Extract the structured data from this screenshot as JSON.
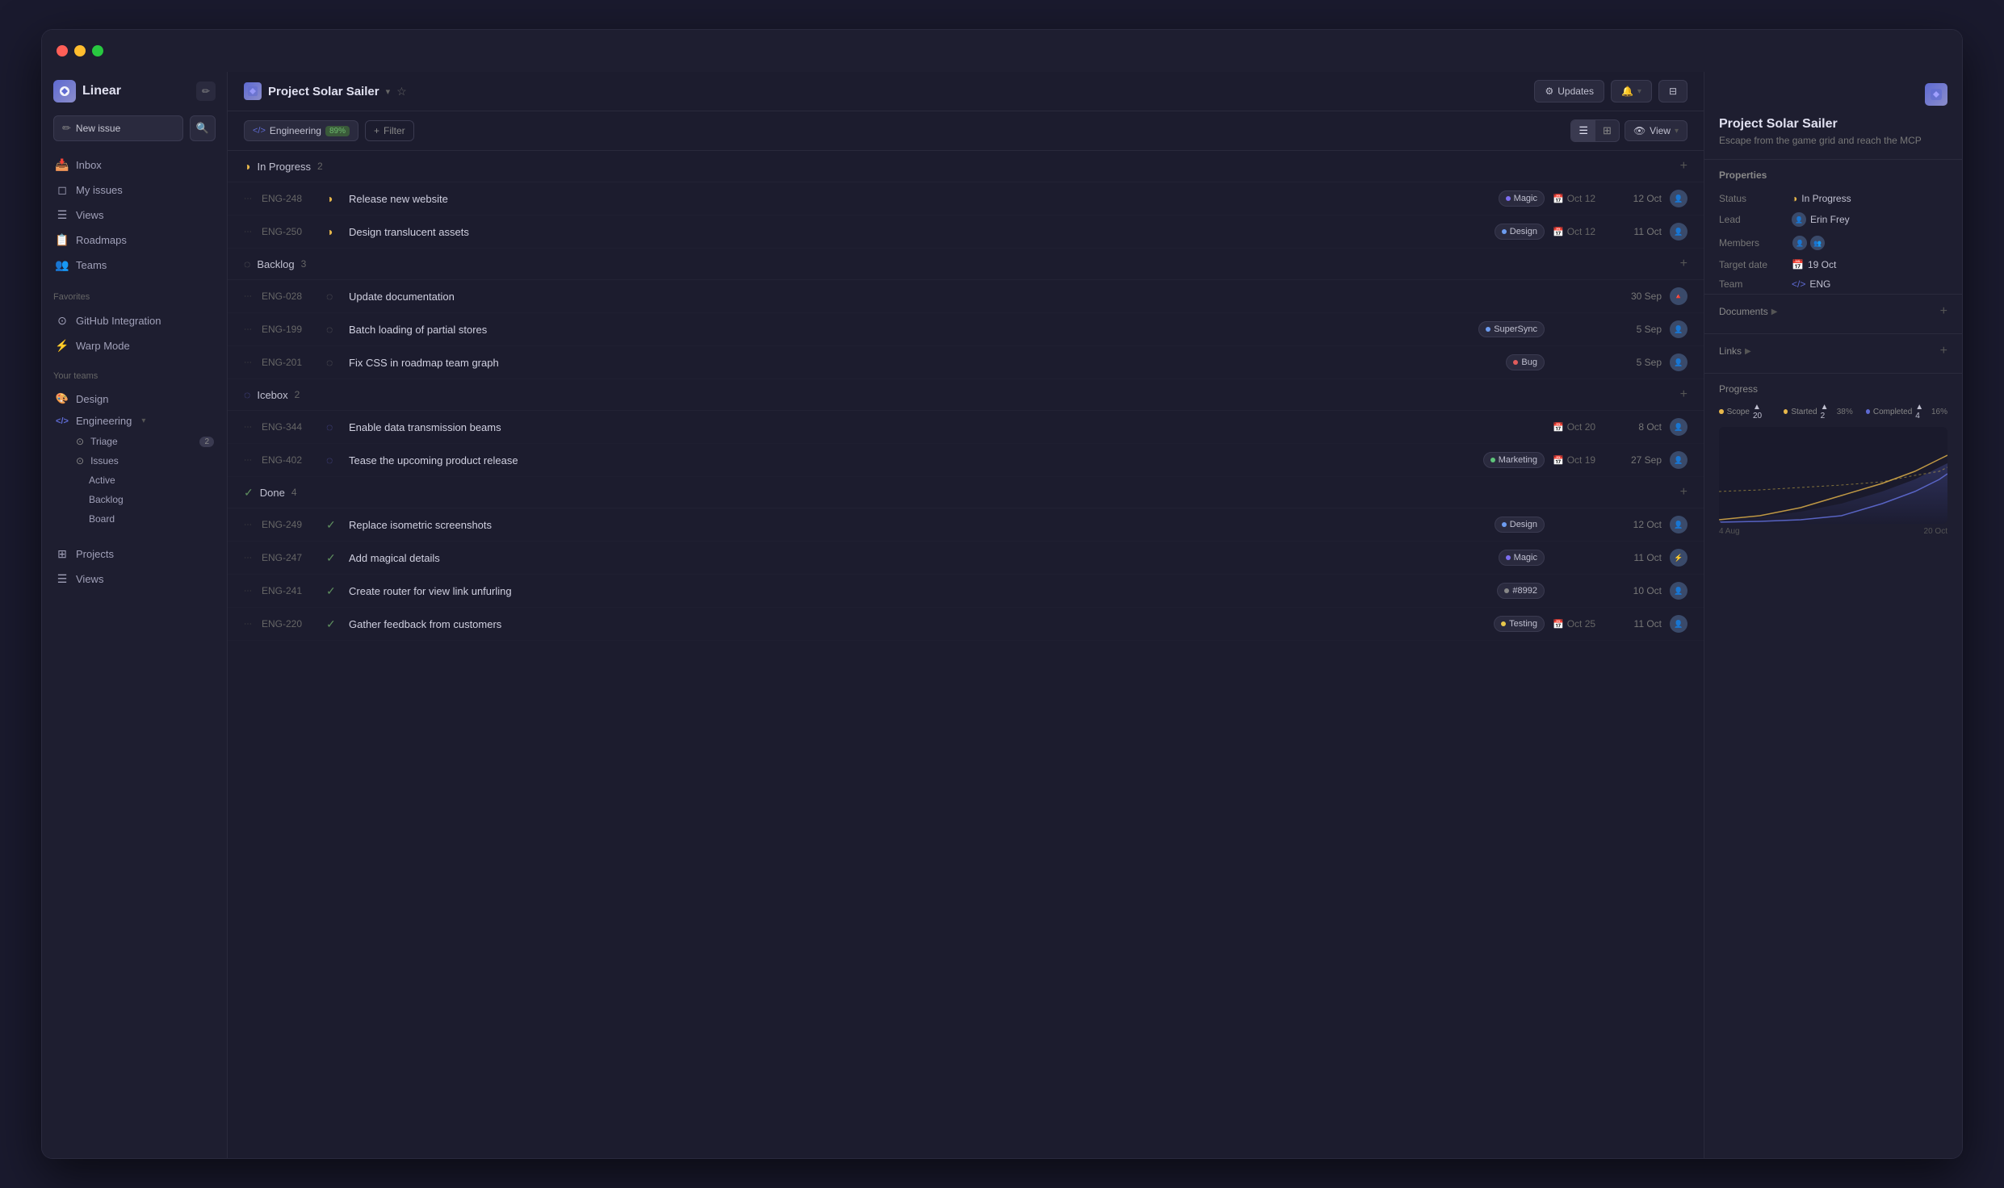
{
  "window": {
    "title": "Linear - Project Solar Sailer"
  },
  "sidebar": {
    "brand": "Linear",
    "brand_icon": "🚀",
    "new_issue_label": "New issue",
    "nav_items": [
      {
        "id": "inbox",
        "label": "Inbox",
        "icon": "📥"
      },
      {
        "id": "my_issues",
        "label": "My issues",
        "icon": "🔲"
      },
      {
        "id": "views",
        "label": "Views",
        "icon": "☰"
      },
      {
        "id": "roadmaps",
        "label": "Roadmaps",
        "icon": "🗺"
      },
      {
        "id": "teams",
        "label": "Teams",
        "icon": "👥"
      }
    ],
    "favorites_label": "Favorites",
    "favorites": [
      {
        "id": "github",
        "label": "GitHub Integration",
        "icon": "⚙"
      },
      {
        "id": "warp",
        "label": "Warp Mode",
        "icon": "⚡"
      }
    ],
    "your_teams_label": "Your teams",
    "teams": [
      {
        "id": "design",
        "label": "Design",
        "icon": "🎨"
      },
      {
        "id": "engineering",
        "label": "Engineering",
        "icon": "</>",
        "has_arrow": true
      }
    ],
    "engineering_sub": [
      {
        "id": "triage",
        "label": "Triage",
        "badge": "2"
      },
      {
        "id": "issues",
        "label": "Issues"
      }
    ],
    "issues_sub": [
      {
        "id": "active",
        "label": "Active"
      },
      {
        "id": "backlog",
        "label": "Backlog"
      },
      {
        "id": "board",
        "label": "Board"
      }
    ],
    "bottom_items": [
      {
        "id": "projects",
        "label": "Projects",
        "icon": "⊞"
      },
      {
        "id": "views2",
        "label": "Views",
        "icon": "☰"
      }
    ]
  },
  "header": {
    "project_name": "Project Solar Sailer",
    "updates_label": "Updates",
    "team_tag": "Engineering",
    "team_percent": "89%",
    "filter_label": "Filter",
    "view_label": "View"
  },
  "project_detail": {
    "title": "Project Solar Sailer",
    "subtitle": "Escape from the game grid and reach the MCP",
    "properties": {
      "title": "Properties",
      "status_label": "Status",
      "status_value": "In Progress",
      "lead_label": "Lead",
      "lead_value": "Erin Frey",
      "members_label": "Members",
      "target_date_label": "Target date",
      "target_date_value": "19 Oct",
      "team_label": "Team",
      "team_value": "ENG"
    },
    "documents_label": "Documents",
    "links_label": "Links",
    "progress": {
      "title": "Progress",
      "scope_label": "Scope",
      "scope_count": "▲ 20",
      "started_label": "Started",
      "started_count": "▲ 2",
      "started_percent": "38%",
      "completed_label": "Completed",
      "completed_count": "▲ 4",
      "completed_percent": "16%",
      "date_start": "4 Aug",
      "date_end": "20 Oct"
    }
  },
  "groups": [
    {
      "id": "in_progress",
      "name": "In Progress",
      "count": "2",
      "status": "inprogress",
      "issues": [
        {
          "id": "ENG-248",
          "title": "Release new website",
          "labels": [
            {
              "name": "Magic",
              "color": "#7c6ef0"
            }
          ],
          "due_date": "Oct 12",
          "meta_date": "12 Oct",
          "status": "inprogress"
        },
        {
          "id": "ENG-250",
          "title": "Design translucent assets",
          "labels": [
            {
              "name": "Design",
              "color": "#6d9cf0"
            }
          ],
          "due_date": "Oct 12",
          "meta_date": "11 Oct",
          "status": "inprogress"
        }
      ]
    },
    {
      "id": "backlog",
      "name": "Backlog",
      "count": "3",
      "status": "backlog",
      "issues": [
        {
          "id": "ENG-028",
          "title": "Update documentation",
          "labels": [],
          "due_date": "",
          "meta_date": "30 Sep",
          "status": "backlog"
        },
        {
          "id": "ENG-199",
          "title": "Batch loading of partial stores",
          "labels": [
            {
              "name": "SuperSync",
              "color": "#6d9cf0"
            }
          ],
          "due_date": "",
          "meta_date": "5 Sep",
          "status": "backlog"
        },
        {
          "id": "ENG-201",
          "title": "Fix CSS in roadmap team graph",
          "labels": [
            {
              "name": "Bug",
              "color": "#e05c5c"
            }
          ],
          "due_date": "",
          "meta_date": "5 Sep",
          "status": "backlog"
        }
      ]
    },
    {
      "id": "icebox",
      "name": "Icebox",
      "count": "2",
      "status": "icebox",
      "issues": [
        {
          "id": "ENG-344",
          "title": "Enable data transmission beams",
          "labels": [],
          "due_date": "Oct 20",
          "meta_date": "8 Oct",
          "status": "icebox"
        },
        {
          "id": "ENG-402",
          "title": "Tease the upcoming product release",
          "labels": [
            {
              "name": "Marketing",
              "color": "#5ec47a"
            }
          ],
          "due_date": "Oct 19",
          "meta_date": "27 Sep",
          "status": "icebox"
        }
      ]
    },
    {
      "id": "done",
      "name": "Done",
      "count": "4",
      "status": "done",
      "issues": [
        {
          "id": "ENG-249",
          "title": "Replace isometric screenshots",
          "labels": [
            {
              "name": "Design",
              "color": "#6d9cf0"
            }
          ],
          "due_date": "",
          "meta_date": "12 Oct",
          "status": "done"
        },
        {
          "id": "ENG-247",
          "title": "Add magical details",
          "labels": [
            {
              "name": "Magic",
              "color": "#7c6ef0"
            }
          ],
          "due_date": "",
          "meta_date": "11 Oct",
          "status": "done"
        },
        {
          "id": "ENG-241",
          "title": "Create router for view link unfurling",
          "labels": [
            {
              "name": "#8992",
              "color": "#888"
            }
          ],
          "due_date": "",
          "meta_date": "10 Oct",
          "status": "done"
        },
        {
          "id": "ENG-220",
          "title": "Gather feedback from customers",
          "labels": [
            {
              "name": "Testing",
              "color": "#e8c84b"
            }
          ],
          "due_date": "Oct 25",
          "meta_date": "11 Oct",
          "status": "done"
        }
      ]
    }
  ]
}
